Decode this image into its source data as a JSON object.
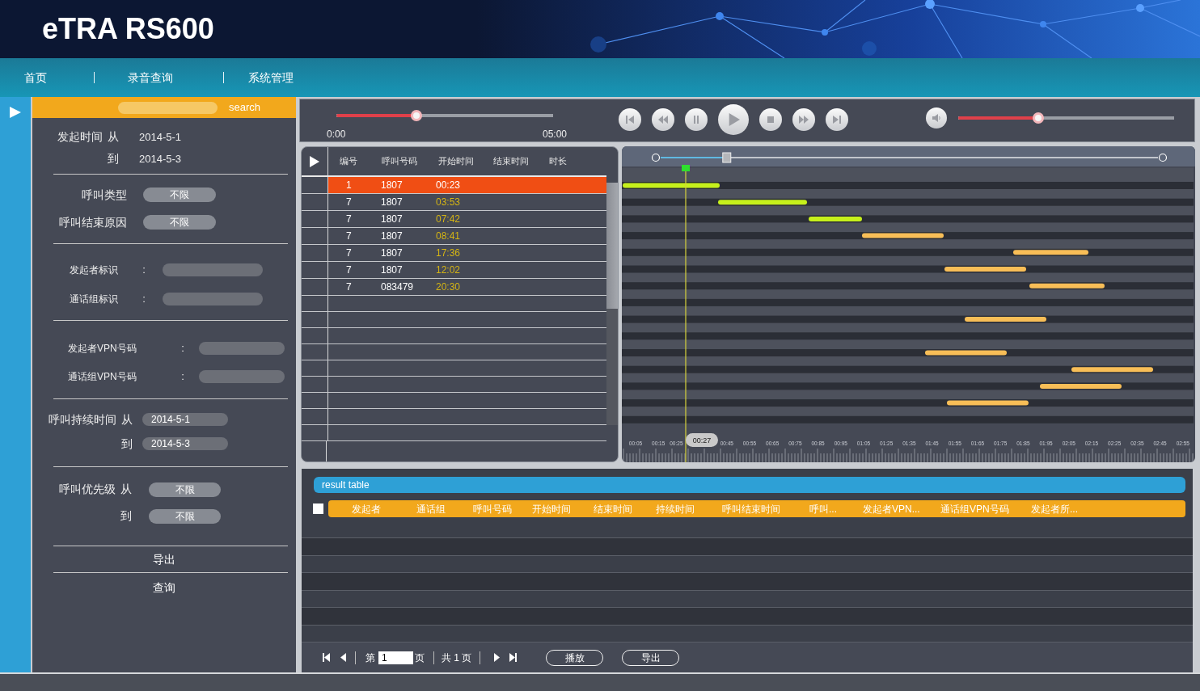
{
  "header": {
    "title": "eTRA RS600"
  },
  "nav": [
    {
      "label": "首页"
    },
    {
      "label": "录音查询"
    },
    {
      "label": "系统管理"
    }
  ],
  "search": {
    "label": "search"
  },
  "filters": [
    {
      "rows": [
        {
          "kind": "text",
          "label": "发起时间",
          "prefix": "从",
          "value": "2014-5-1"
        },
        {
          "kind": "text",
          "prefix": "到",
          "value": "2014-5-3"
        }
      ]
    },
    {
      "rows": [
        {
          "kind": "select",
          "label": "呼叫类型",
          "value": "不限"
        },
        {
          "kind": "select",
          "label": "呼叫结束原因",
          "value": "不限"
        }
      ]
    },
    {
      "rows": [
        {
          "kind": "field",
          "label": "发起者标识",
          "separator": ":"
        },
        {
          "kind": "field",
          "label": "通话组标识",
          "separator": ":"
        }
      ]
    },
    {
      "rows": [
        {
          "kind": "field",
          "label": "发起者VPN号码",
          "separator": ":"
        },
        {
          "kind": "field",
          "label": "通话组VPN号码",
          "separator": ":"
        }
      ]
    },
    {
      "rows": [
        {
          "kind": "field",
          "label": "呼叫持续时间",
          "prefix": "从",
          "value": "2014-5-1"
        },
        {
          "kind": "field",
          "prefix": "到",
          "value": "2014-5-3"
        }
      ]
    },
    {
      "rows": [
        {
          "kind": "select",
          "label": "呼叫优先级",
          "prefix": "从",
          "value": "不限"
        },
        {
          "kind": "select",
          "prefix": "到",
          "value": "不限"
        }
      ]
    }
  ],
  "actions": [
    {
      "label": "导出"
    },
    {
      "label": "查询"
    }
  ],
  "player": {
    "position": {
      "level": 0.37
    },
    "time_start": "0:00",
    "time_end": "05:00",
    "volume": {
      "level": 0.37
    }
  },
  "calls": {
    "columns": [
      "编号",
      "呼叫号码",
      "开始时间",
      "结束时间",
      "时长"
    ],
    "rows": [
      {
        "selected": true,
        "cells": [
          "1",
          "1807",
          "00:23"
        ]
      },
      {
        "selected": false,
        "cells": [
          "7",
          "1807",
          "03:53"
        ]
      },
      {
        "selected": false,
        "cells": [
          "7",
          "1807",
          "07:42"
        ]
      },
      {
        "selected": false,
        "cells": [
          "7",
          "1807",
          "08:41"
        ]
      },
      {
        "selected": false,
        "cells": [
          "7",
          "1807",
          "17:36"
        ]
      },
      {
        "selected": false,
        "cells": [
          "7",
          "1807",
          "12:02"
        ]
      },
      {
        "selected": false,
        "cells": [
          "7",
          "083479",
          "20:30"
        ]
      }
    ]
  },
  "timeline": {
    "slider": {
      "level": 0.14
    },
    "playhead": "00:27",
    "bars": [
      {
        "color": "#c6f01b"
      },
      {
        "color": "#c6f01b"
      },
      {
        "color": "#c6f01b"
      },
      {
        "color": "#f8be57"
      },
      {
        "color": "#f8be57"
      },
      {
        "color": "#f8be57"
      },
      {
        "color": "#f8be57"
      },
      {
        "color": "#f8be57"
      },
      {
        "color": "#f8be57"
      },
      {
        "color": "#f8be57"
      },
      {
        "color": "#f8be57"
      },
      {
        "color": "#f8be57"
      }
    ],
    "scale_labels": [
      "00:05",
      "00:15",
      "00:25",
      "00:45",
      "00:55",
      "00:65",
      "00:75",
      "00:85",
      "00:95",
      "01:05",
      "01:25",
      "01:35",
      "01:45",
      "01:55",
      "01:65",
      "01:75",
      "01:85",
      "01:95",
      "02:05",
      "02:15",
      "02:25",
      "02:35",
      "02:45",
      "02:55"
    ]
  },
  "results": {
    "title": "result table",
    "select_all": {
      "checked": false
    },
    "columns": [
      "发起者",
      "通话组",
      "呼叫号码",
      "开始时间",
      "结束时间",
      "持续时间",
      "呼叫结束时间",
      "呼叫...",
      "发起者VPN...",
      "通话组VPN号码",
      "发起者所..."
    ]
  },
  "pager": {
    "page_prefix": "第",
    "page": "1",
    "page_suffix": "页",
    "total": "共 1 页",
    "buttons": [
      {
        "label": "播放"
      },
      {
        "label": "导出"
      }
    ]
  }
}
